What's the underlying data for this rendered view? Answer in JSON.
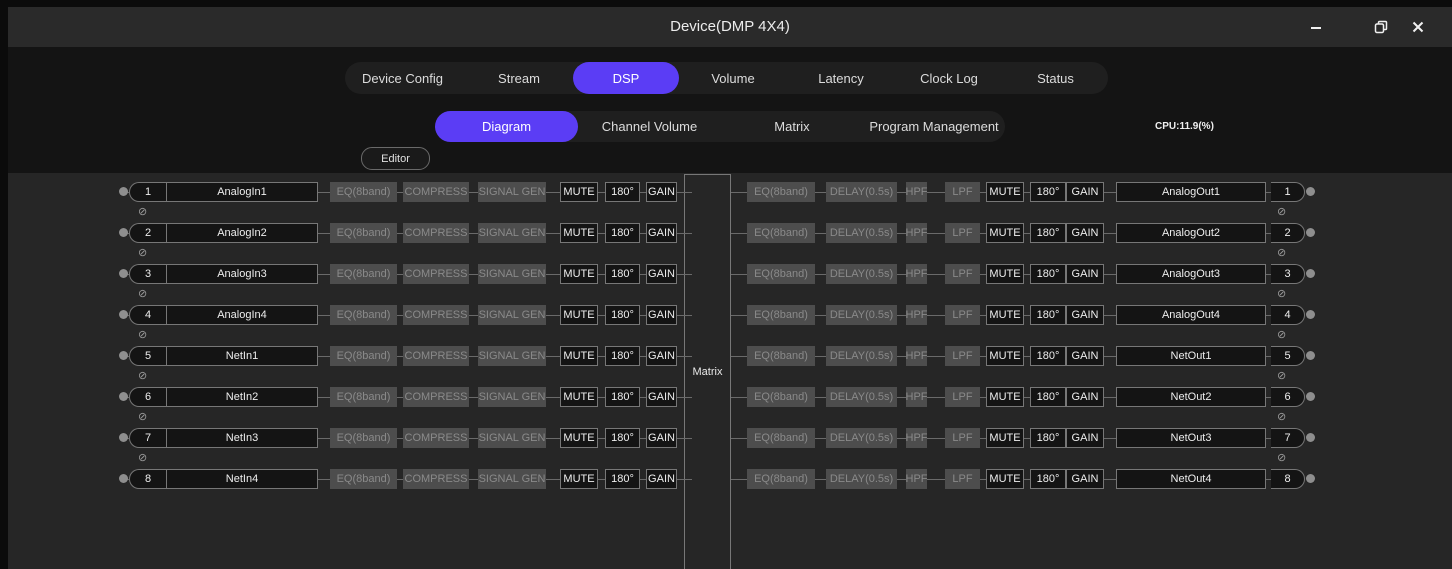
{
  "window": {
    "title": "Device(DMP 4X4)"
  },
  "main_tabs": [
    {
      "label": "Device Config",
      "active": false
    },
    {
      "label": "Stream",
      "active": false
    },
    {
      "label": "DSP",
      "active": true
    },
    {
      "label": "Volume",
      "active": false
    },
    {
      "label": "Latency",
      "active": false
    },
    {
      "label": "Clock Log",
      "active": false
    },
    {
      "label": "Status",
      "active": false
    }
  ],
  "sub_tabs": [
    {
      "label": "Diagram",
      "active": true
    },
    {
      "label": "Channel Volume",
      "active": false
    },
    {
      "label": "Matrix",
      "active": false
    },
    {
      "label": "Program Management",
      "active": false
    }
  ],
  "cpu_label": "CPU:11.9(%)",
  "editor_label": "Editor",
  "matrix_label": "Matrix",
  "link_icon": "⊘",
  "input_blocks": {
    "eq": "EQ(8band)",
    "compress": "COMPRESS",
    "signal_gen": "SIGNAL GEN",
    "mute": "MUTE",
    "phase": "180°",
    "gain": "GAIN"
  },
  "output_blocks": {
    "eq": "EQ(8band)",
    "delay": "DELAY(0.5s)",
    "hpf": "HPF",
    "lpf": "LPF",
    "mute": "MUTE",
    "phase": "180°",
    "gain": "GAIN"
  },
  "inputs": [
    {
      "num": "1",
      "name": "AnalogIn1"
    },
    {
      "num": "2",
      "name": "AnalogIn2"
    },
    {
      "num": "3",
      "name": "AnalogIn3"
    },
    {
      "num": "4",
      "name": "AnalogIn4"
    },
    {
      "num": "5",
      "name": "NetIn1"
    },
    {
      "num": "6",
      "name": "NetIn2"
    },
    {
      "num": "7",
      "name": "NetIn3"
    },
    {
      "num": "8",
      "name": "NetIn4"
    }
  ],
  "outputs": [
    {
      "num": "1",
      "name": "AnalogOut1"
    },
    {
      "num": "2",
      "name": "AnalogOut2"
    },
    {
      "num": "3",
      "name": "AnalogOut3"
    },
    {
      "num": "4",
      "name": "AnalogOut4"
    },
    {
      "num": "5",
      "name": "NetOut1"
    },
    {
      "num": "6",
      "name": "NetOut2"
    },
    {
      "num": "7",
      "name": "NetOut3"
    },
    {
      "num": "8",
      "name": "NetOut4"
    }
  ]
}
